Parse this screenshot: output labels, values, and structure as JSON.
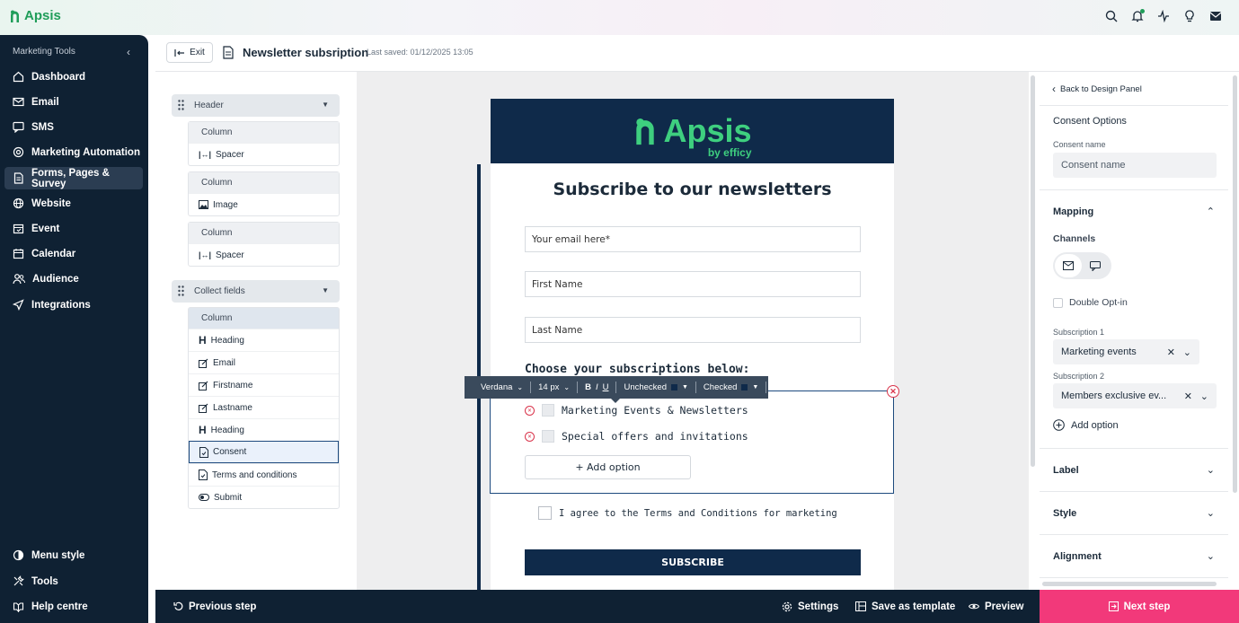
{
  "app": {
    "brand": "Apsis"
  },
  "colors": {
    "brand_green": "#1f9d59",
    "navy": "#0f2133",
    "accent_pink": "#f2397a",
    "error_red": "#d9344b"
  },
  "topbar": {
    "icons": [
      "search-icon",
      "bell-icon",
      "activity-icon",
      "lightbulb-icon",
      "inbox-icon"
    ]
  },
  "sidebar": {
    "title": "Marketing Tools",
    "items": [
      {
        "label": "Dashboard",
        "icon": "home-icon"
      },
      {
        "label": "Email",
        "icon": "mail-icon"
      },
      {
        "label": "SMS",
        "icon": "sms-icon"
      },
      {
        "label": "Marketing Automation",
        "icon": "automation-icon"
      },
      {
        "label": "Forms, Pages & Survey",
        "icon": "forms-icon",
        "active": true
      },
      {
        "label": "Website",
        "icon": "globe-icon"
      },
      {
        "label": "Event",
        "icon": "event-icon"
      },
      {
        "label": "Calendar",
        "icon": "calendar-icon"
      },
      {
        "label": "Audience",
        "icon": "audience-icon"
      },
      {
        "label": "Integrations",
        "icon": "integrations-icon"
      }
    ],
    "bottom": [
      {
        "label": "Menu style",
        "icon": "palette-icon"
      },
      {
        "label": "Tools",
        "icon": "tools-icon"
      },
      {
        "label": "Help centre",
        "icon": "help-icon"
      }
    ]
  },
  "header": {
    "exit_label": "Exit",
    "title": "Newsletter subsription",
    "last_saved": "Last saved: 01/12/2025 13:05"
  },
  "structure": {
    "header_group": "Header",
    "header_cards": [
      {
        "column": "Column",
        "item": "Spacer"
      },
      {
        "column": "Column",
        "item": "Image"
      },
      {
        "column": "Column",
        "item": "Spacer"
      }
    ],
    "collect_group": "Collect fields",
    "collect_column": "Column",
    "collect_items": [
      "Heading",
      "Email",
      "Firstname",
      "Lastname",
      "Heading",
      "Consent",
      "Terms and conditions",
      "Submit"
    ]
  },
  "form": {
    "banner_logo": "Apsis",
    "banner_sub": "by efficy",
    "heading": "Subscribe to our newsletters",
    "email_placeholder": "Your email here*",
    "first_name": "First Name",
    "last_name": "Last Name",
    "choose": "Choose your subscriptions below:",
    "options": [
      "Marketing Events & Newsletters",
      "Special offers and invitations"
    ],
    "add_option": "+ Add option",
    "terms": "I agree to the Terms and Conditions for marketing",
    "submit": "SUBSCRIBE"
  },
  "toolbar": {
    "font": "Verdana",
    "size": "14 px",
    "bold": "B",
    "italic": "I",
    "underline": "U",
    "unchecked": "Unchecked",
    "checked": "Checked"
  },
  "right_panel": {
    "back": "Back to Design Panel",
    "section_title": "Consent Options",
    "consent_name_label": "Consent name",
    "consent_name_placeholder": "Consent name",
    "mapping": "Mapping",
    "channels": "Channels",
    "double_optin": "Double Opt-in",
    "sub1_label": "Subscription 1",
    "sub1_value": "Marketing events",
    "sub2_label": "Subscription 2",
    "sub2_value": "Members exclusive ev...",
    "add_option": "Add option",
    "label": "Label",
    "style": "Style",
    "alignment": "Alignment"
  },
  "bottombar": {
    "previous": "Previous step",
    "settings": "Settings",
    "save_template": "Save as template",
    "preview": "Preview",
    "next": "Next step"
  }
}
